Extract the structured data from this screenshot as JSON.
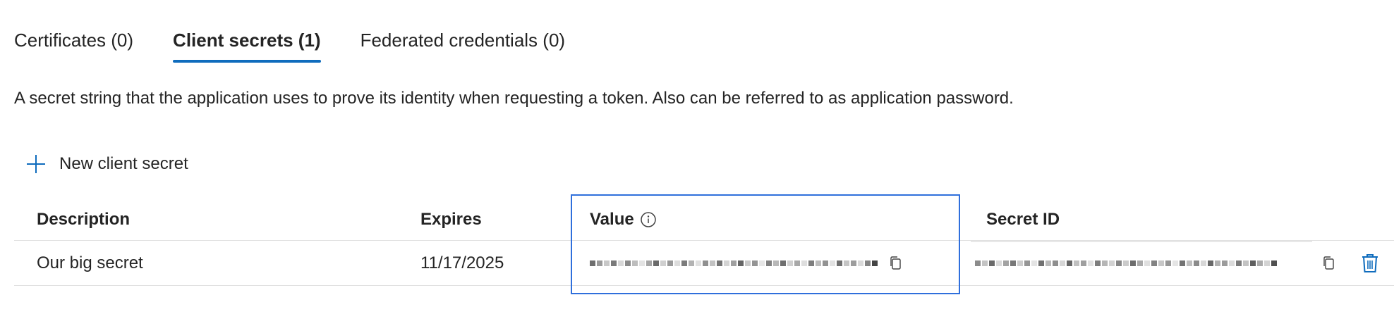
{
  "tabs": [
    {
      "label": "Certificates (0)",
      "active": false
    },
    {
      "label": "Client secrets (1)",
      "active": true
    },
    {
      "label": "Federated credentials (0)",
      "active": false
    }
  ],
  "description": "A secret string that the application uses to prove its identity when requesting a token. Also can be referred to as application password.",
  "new_secret_label": "New client secret",
  "table": {
    "headers": {
      "description": "Description",
      "expires": "Expires",
      "value": "Value",
      "secret_id": "Secret ID"
    },
    "rows": [
      {
        "description": "Our big secret",
        "expires": "11/17/2025",
        "value": "(redacted)",
        "secret_id": "(redacted)"
      }
    ]
  },
  "icons": {
    "add": "plus-icon",
    "info": "info-icon",
    "copy": "copy-icon",
    "delete": "trash-icon"
  },
  "colors": {
    "accent": "#0f6cbd",
    "highlight_box": "#2f6fdc",
    "delete_icon": "#0f6cbd"
  }
}
